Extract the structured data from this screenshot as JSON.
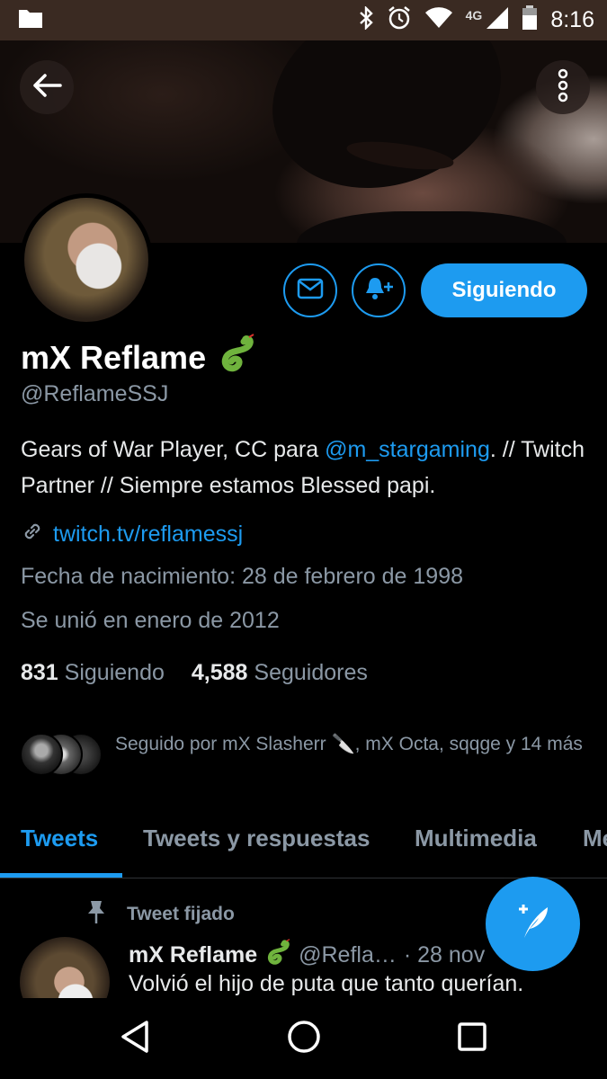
{
  "status_bar": {
    "time": "8:16",
    "network": "4G"
  },
  "profile": {
    "name": "mX Reflame",
    "handle": "@ReflameSSJ",
    "bio_prefix": "Gears of War Player, CC para ",
    "bio_mention": "@m_stargaming",
    "bio_suffix": ".   // Twitch Partner // Siempre estamos Blessed papi.",
    "website": "twitch.tv/reflamessj",
    "birthdate": "Fecha de nacimiento: 28 de febrero de 1998",
    "joined": "Se unió en enero de 2012",
    "following_count": "831",
    "following_label": "Siguiendo",
    "followers_count": "4,588",
    "followers_label": "Seguidores",
    "followed_by": "Seguido por mX Slasherr 🔪, mX Octa, sqqge y 14 más"
  },
  "actions": {
    "follow_button": "Siguiendo"
  },
  "tabs": [
    {
      "label": "Tweets"
    },
    {
      "label": "Tweets y respuestas"
    },
    {
      "label": "Multimedia"
    },
    {
      "label": "Me"
    }
  ],
  "pinned_tweet": {
    "pinned_label": "Tweet fijado",
    "author": "mX Reflame",
    "handle": "@Refla…",
    "date": "· 28 nov",
    "text": "Volvió el hijo de puta que tanto querían."
  },
  "colors": {
    "accent": "#1d9bf0",
    "background": "#000000",
    "muted": "#8b98a5"
  }
}
